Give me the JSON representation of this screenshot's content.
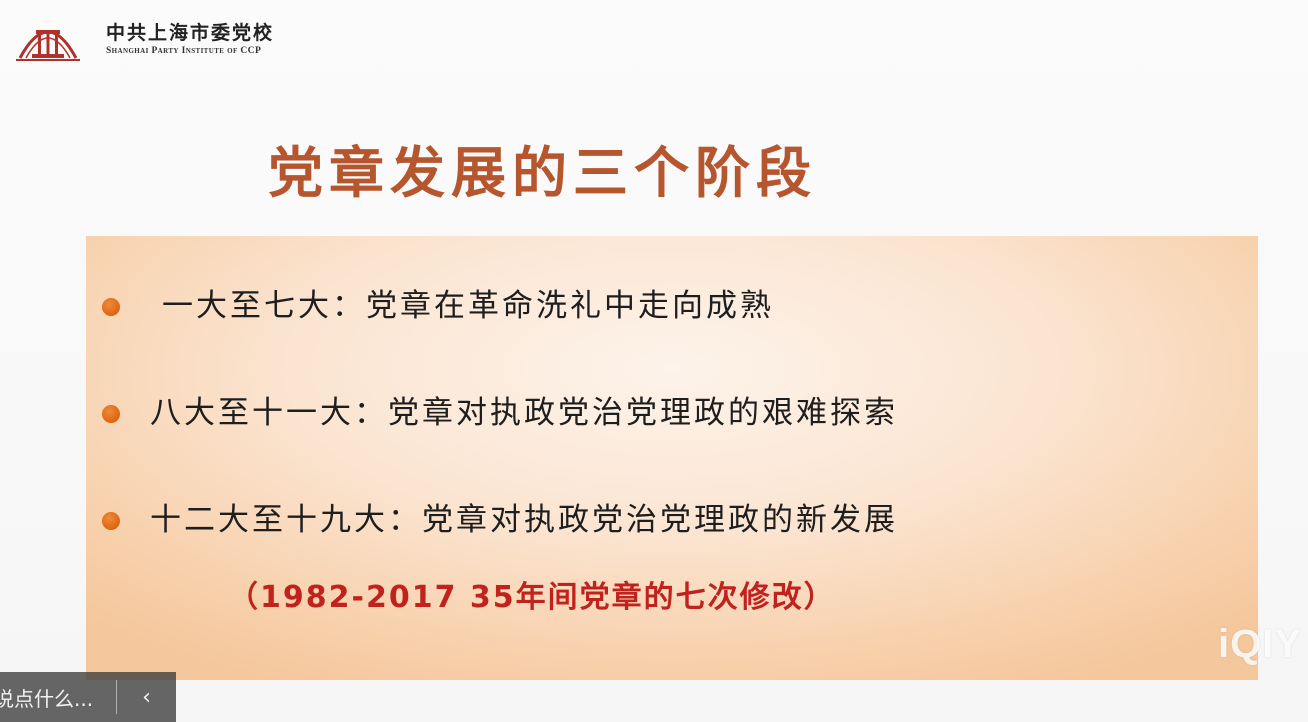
{
  "header": {
    "org_name_cn": "中共上海市委党校",
    "org_name_en": "Shanghai Party Institute of CCP",
    "emblem_icon": "party-school-emblem-icon"
  },
  "slide": {
    "title": "党章发展的三个阶段",
    "items": [
      {
        "text": "一大至七大：党章在革命洗礼中走向成熟"
      },
      {
        "text": "八大至十一大：党章对执政党治党理政的艰难探索"
      },
      {
        "text": "十二大至十九大：党章对执政党治党理政的新发展"
      }
    ],
    "note": "（1982-2017   35年间党章的七次修改）"
  },
  "watermark": {
    "text": "iQIY"
  },
  "chat_bar": {
    "placeholder": "说点什么...",
    "collapse_glyph": "‹"
  },
  "colors": {
    "title": "#b5562f",
    "bullet": "#e06a16",
    "note": "#c0231e",
    "box_light": "#fdf3ea",
    "box_dark": "#f5c79d"
  }
}
